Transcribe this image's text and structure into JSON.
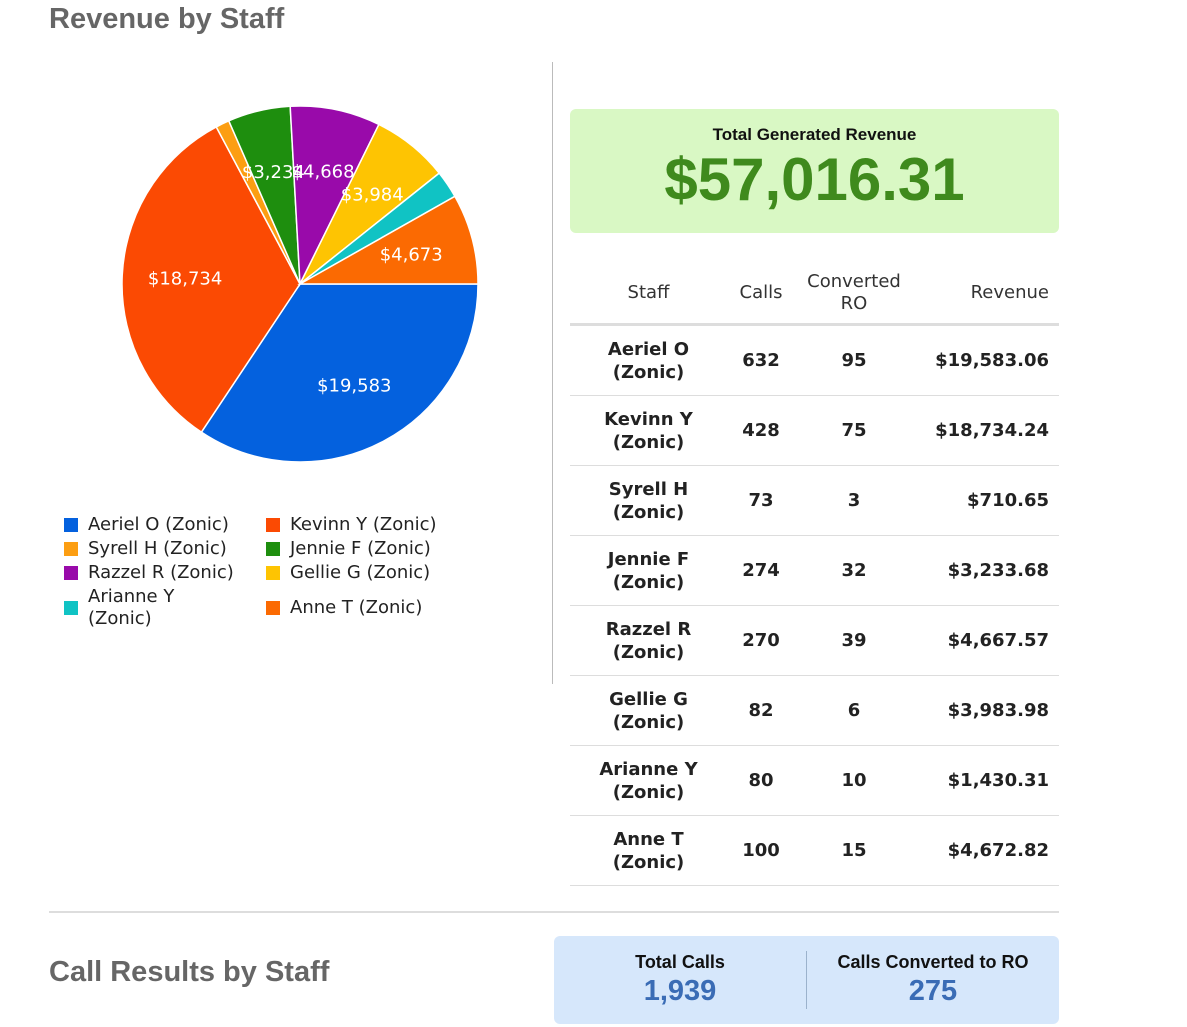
{
  "titles": {
    "revenue": "Revenue by Staff",
    "calls": "Call Results by Staff"
  },
  "revenue_box": {
    "label": "Total Generated Revenue",
    "value": "$57,016.31",
    "background": "#d9f8c4",
    "value_color": "#3f8a1d"
  },
  "calls_box": {
    "total_calls_label": "Total Calls",
    "total_calls_value": "1,939",
    "converted_label": "Calls Converted to RO",
    "converted_value": "275",
    "background": "#d6e7fb",
    "value_color": "#3a6cb5"
  },
  "table": {
    "headers": {
      "staff": "Staff",
      "calls": "Calls",
      "converted_line1": "Converted",
      "converted_line2": "RO",
      "revenue": "Revenue"
    },
    "rows": [
      {
        "name": "Aeriel O",
        "team": "(Zonic)",
        "calls": "632",
        "converted": "95",
        "revenue": "$19,583.06"
      },
      {
        "name": "Kevinn Y",
        "team": "(Zonic)",
        "calls": "428",
        "converted": "75",
        "revenue": "$18,734.24"
      },
      {
        "name": "Syrell H",
        "team": "(Zonic)",
        "calls": "73",
        "converted": "3",
        "revenue": "$710.65"
      },
      {
        "name": "Jennie F",
        "team": "(Zonic)",
        "calls": "274",
        "converted": "32",
        "revenue": "$3,233.68"
      },
      {
        "name": "Razzel R",
        "team": "(Zonic)",
        "calls": "270",
        "converted": "39",
        "revenue": "$4,667.57"
      },
      {
        "name": "Gellie G",
        "team": "(Zonic)",
        "calls": "82",
        "converted": "6",
        "revenue": "$3,983.98"
      },
      {
        "name": "Arianne Y",
        "team": "(Zonic)",
        "calls": "80",
        "converted": "10",
        "revenue": "$1,430.31"
      },
      {
        "name": "Anne T",
        "team": "(Zonic)",
        "calls": "100",
        "converted": "15",
        "revenue": "$4,672.82"
      }
    ]
  },
  "chart_data": {
    "type": "pie",
    "title": "Revenue by Staff",
    "legend_placement": "bottom",
    "slices": [
      {
        "name": "Aeriel O (Zonic)",
        "value": 19583.06,
        "label": "$19,583",
        "color": "#0461de"
      },
      {
        "name": "Kevinn Y (Zonic)",
        "value": 18734.24,
        "label": "$18,734",
        "color": "#fb4a03"
      },
      {
        "name": "Syrell H (Zonic)",
        "value": 710.65,
        "label": "",
        "color": "#fc9e12"
      },
      {
        "name": "Jennie F (Zonic)",
        "value": 3233.68,
        "label": "$3,234",
        "color": "#1e8e0e"
      },
      {
        "name": "Razzel R (Zonic)",
        "value": 4667.57,
        "label": "$4,668",
        "color": "#990aaa"
      },
      {
        "name": "Gellie G (Zonic)",
        "value": 3983.98,
        "label": "$3,984",
        "color": "#fec402"
      },
      {
        "name": "Arianne Y (Zonic)",
        "value": 1430.31,
        "label": "",
        "color": "#10c3c4"
      },
      {
        "name": "Anne T (Zonic)",
        "value": 4672.82,
        "label": "$4,673",
        "color": "#fb6a02"
      }
    ]
  }
}
